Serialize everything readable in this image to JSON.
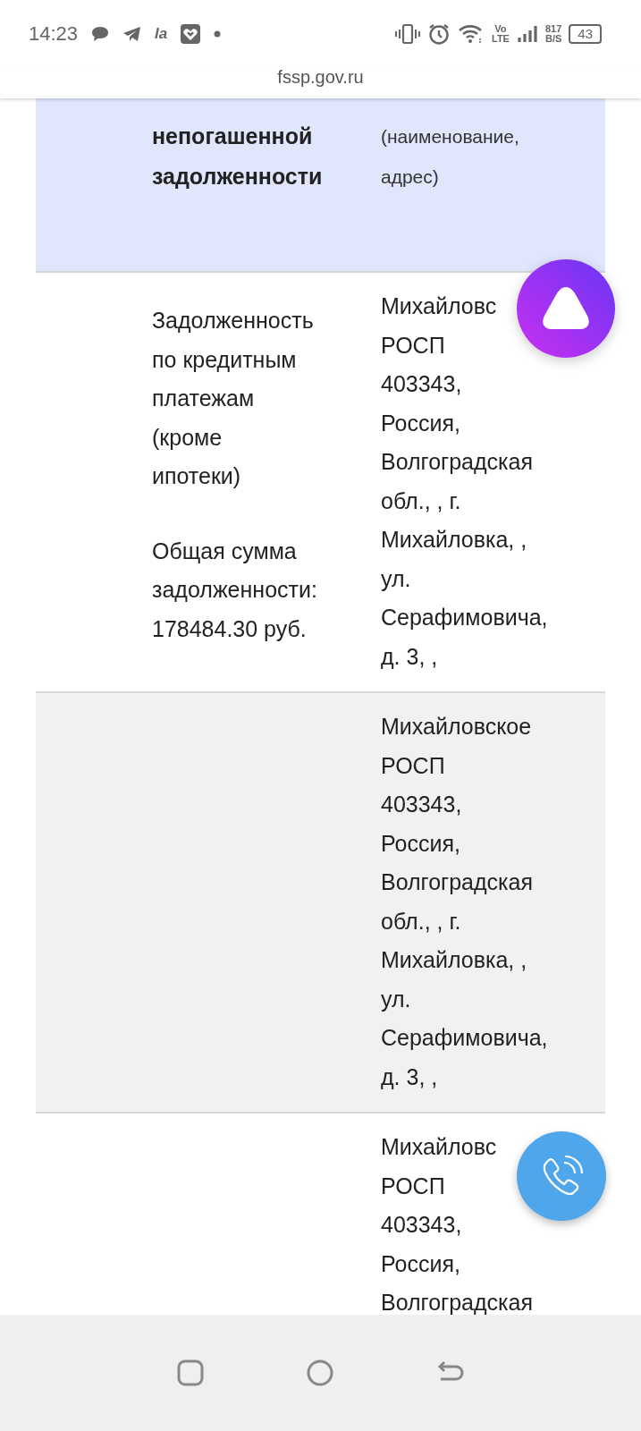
{
  "status_bar": {
    "time": "14:23",
    "app_label": "la",
    "volte": [
      "Vo",
      "LTE"
    ],
    "speed": [
      "817",
      "B/S"
    ],
    "battery": "43"
  },
  "address_bar": {
    "url": "fssp.gov.ru"
  },
  "table": {
    "header": {
      "column_2": {
        "text": "непогашенной\nзадолженности",
        "bold": true
      },
      "column_3": {
        "text": "(наименование,\nадрес)",
        "bold": false
      }
    },
    "rows": [
      {
        "shaded": false,
        "column_2": [
          "Задолженность\nпо кредитным\nплатежам\n(кроме\nипотеки)",
          "Общая сумма\nзадолженности:\n178484.30 руб."
        ],
        "column_3": [
          "Михайловс",
          "РОСП",
          "403343,\nРоссия,\nВолгоградская\nобл., , г.\nМихайловка, ,\nул.\nСерафимовича,\nд. 3, ,"
        ]
      },
      {
        "shaded": true,
        "column_3": [
          "Михайловское",
          "РОСП",
          "403343,\nРоссия,\nВолгоградская\nобл., , г.\nМихайловка, ,\nул.\nСерафимовича,\nд. 3, ,"
        ]
      },
      {
        "shaded": false,
        "column_3": [
          "Михайловс",
          "РОСП",
          "403343,\nРоссия,\nВолгоградская"
        ]
      }
    ]
  }
}
